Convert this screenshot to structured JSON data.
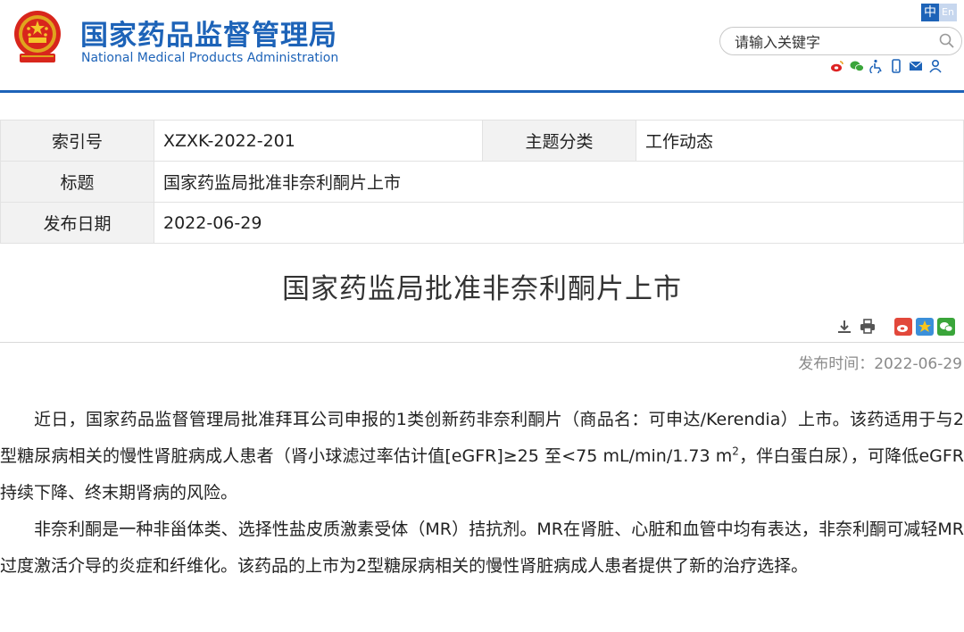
{
  "header": {
    "site_title": "国家药品监督管理局",
    "site_subtitle": "National Medical Products Administration",
    "lang_zh": "中",
    "lang_en": "En",
    "search_placeholder": "请输入关键字",
    "brand_color": "#1d63b8"
  },
  "meta": {
    "index_label": "索引号",
    "index_value": "XZXK-2022-201",
    "category_label": "主题分类",
    "category_value": "工作动态",
    "title_label": "标题",
    "title_value": "国家药监局批准非奈利酮片上市",
    "date_label": "发布日期",
    "date_value": "2022-06-29"
  },
  "article": {
    "title": "国家药监局批准非奈利酮片上市",
    "publish_time": "发布时间：2022-06-29",
    "paragraph1": "近日，国家药品监督管理局批准拜耳公司申报的1类创新药非奈利酮片（商品名：可申达/Kerendia）上市。该药适用于与2型糖尿病相关的慢性肾脏病成人患者（肾小球滤过率估计值[eGFR]≥25 至<75 mL/min/1.73 m",
    "paragraph1_sup": "2",
    "paragraph1_end": "，伴白蛋白尿），可降低eGFR持续下降、终末期肾病的风险。",
    "paragraph2": "非奈利酮是一种非甾体类、选择性盐皮质激素受体（MR）拮抗剂。MR在肾脏、心脏和血管中均有表达，非奈利酮可减轻MR过度激活介导的炎症和纤维化。该药品的上市为2型糖尿病相关的慢性肾脏病成人患者提供了新的治疗选择。"
  },
  "icons": {
    "header_tools": [
      "weibo-icon",
      "wechat-icon",
      "accessibility-icon",
      "mobile-icon",
      "mail-icon",
      "user-icon"
    ],
    "actions": [
      "download-icon",
      "print-icon"
    ],
    "share": [
      "weibo-share-icon",
      "qzone-share-icon",
      "wechat-share-icon"
    ]
  }
}
